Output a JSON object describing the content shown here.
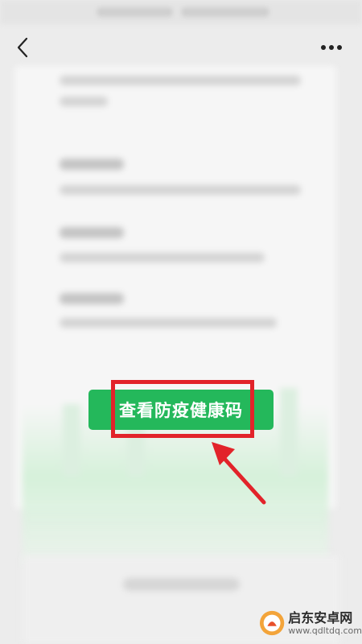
{
  "icons": {
    "back": "chevron-left-icon",
    "more": "more-dots-icon"
  },
  "main_button": {
    "label": "查看防疫健康码"
  },
  "annotation": {
    "box_color": "#e2232a",
    "arrow_color": "#e2232a"
  },
  "watermark": {
    "title": "启东安卓网",
    "url": "www.qdltdq.com"
  },
  "colors": {
    "button_green": "#24b85b",
    "background": "#ececec"
  }
}
